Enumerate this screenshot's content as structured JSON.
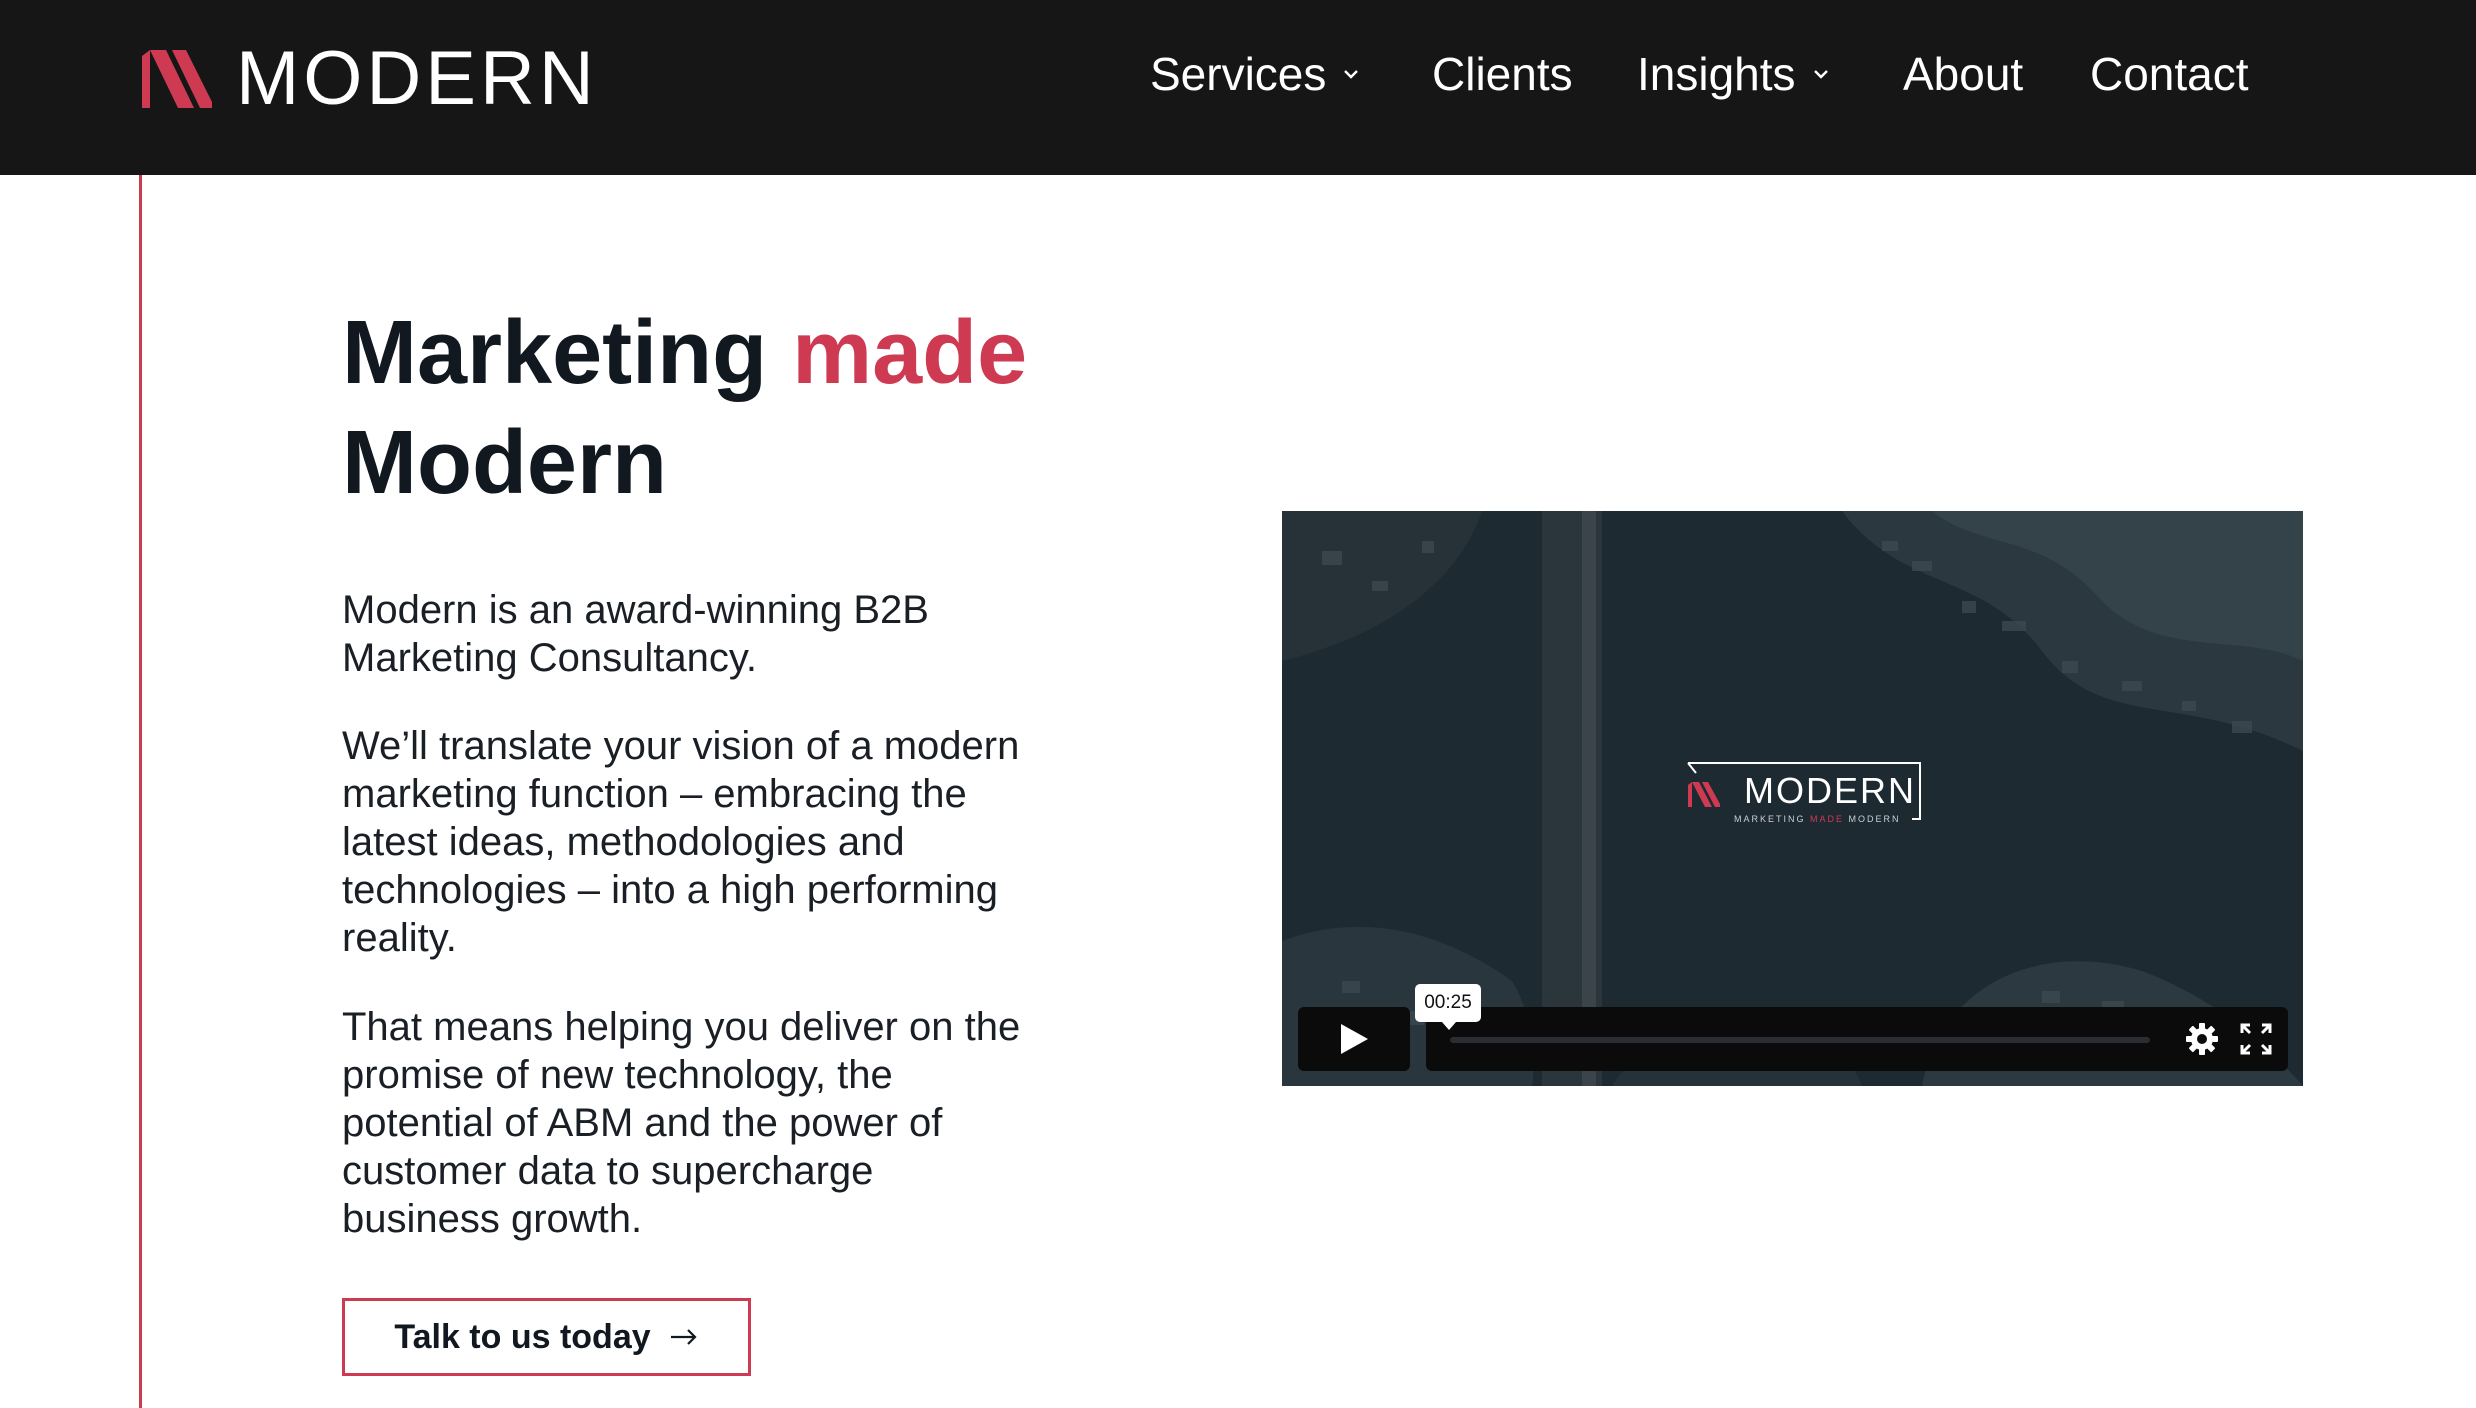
{
  "header": {
    "logo_text": "MODERN",
    "nav": [
      {
        "label": "Services",
        "has_dropdown": true
      },
      {
        "label": "Clients",
        "has_dropdown": false
      },
      {
        "label": "Insights",
        "has_dropdown": true
      },
      {
        "label": "About",
        "has_dropdown": false
      },
      {
        "label": "Contact",
        "has_dropdown": false
      }
    ]
  },
  "hero": {
    "title_part1": "Marketing ",
    "title_accent": "made",
    "title_part2": "Modern",
    "paragraphs": [
      "Modern is an award-winning B2B Marketing Consultancy.",
      "We’ll translate your vision of a modern marketing function – embracing the latest ideas, methodologies and technologies – into a high performing reality.",
      "That means helping you deliver on the promise of new technology, the potential of ABM and the power of customer data to supercharge business growth."
    ],
    "cta_label": "Talk to us today"
  },
  "video": {
    "logo_text": "MODERN",
    "tagline_part1": "MARKETING ",
    "tagline_accent": "MADE",
    "tagline_part2": " MODERN",
    "time": "00:25",
    "progress": 0.0
  },
  "colors": {
    "accent": "#cf3a53",
    "header_bg": "#161616",
    "video_bg": "#1f2b33"
  },
  "icons": {
    "logo": "modern-logo-mark-icon",
    "nav_dropdown": "chevron-down-icon",
    "cta": "arrow-right-icon",
    "play": "play-icon",
    "settings": "gear-icon",
    "fullscreen": "fullscreen-icon"
  }
}
